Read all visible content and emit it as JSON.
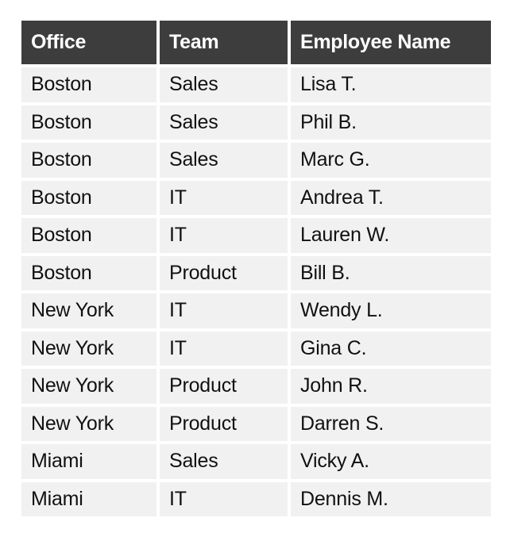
{
  "table": {
    "headers": [
      "Office",
      "Team",
      "Employee Name"
    ],
    "rows": [
      [
        "Boston",
        "Sales",
        "Lisa T."
      ],
      [
        "Boston",
        "Sales",
        "Phil B."
      ],
      [
        "Boston",
        "Sales",
        "Marc G."
      ],
      [
        "Boston",
        "IT",
        "Andrea T."
      ],
      [
        "Boston",
        "IT",
        "Lauren W."
      ],
      [
        "Boston",
        "Product",
        "Bill B."
      ],
      [
        "New York",
        "IT",
        "Wendy L."
      ],
      [
        "New York",
        "IT",
        "Gina C."
      ],
      [
        "New York",
        "Product",
        "John R."
      ],
      [
        "New York",
        "Product",
        "Darren S."
      ],
      [
        "Miami",
        "Sales",
        "Vicky A."
      ],
      [
        "Miami",
        "IT",
        "Dennis M."
      ]
    ]
  },
  "colors": {
    "header_bg": "#3d3d3d",
    "header_text": "#ffffff",
    "row_bg": "#f1f1f1",
    "row_text": "#111111"
  }
}
